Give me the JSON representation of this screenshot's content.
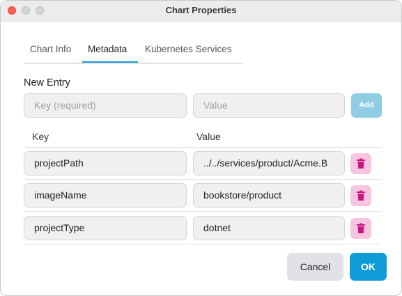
{
  "window": {
    "title": "Chart Properties"
  },
  "tabs": [
    {
      "label": "Chart Info"
    },
    {
      "label": "Metadata"
    },
    {
      "label": "Kubernetes Services"
    }
  ],
  "active_tab": "Metadata",
  "new_entry": {
    "heading": "New Entry",
    "key_placeholder": "Key (required)",
    "value_placeholder": "Value",
    "add_label": "Add"
  },
  "table": {
    "headers": {
      "key": "Key",
      "value": "Value"
    },
    "rows": [
      {
        "key": "projectPath",
        "value": "../../services/product/Acme.B"
      },
      {
        "key": "imageName",
        "value": "bookstore/product"
      },
      {
        "key": "projectType",
        "value": "dotnet"
      }
    ]
  },
  "footer": {
    "cancel_label": "Cancel",
    "ok_label": "OK"
  },
  "colors": {
    "accent": "#0f9bd7",
    "add_disabled": "#8fcde5",
    "delete_bg": "#f6c6e1",
    "delete_icon": "#c8177f"
  },
  "icons": [
    "close-icon",
    "minimize-icon",
    "zoom-icon",
    "trash-icon"
  ]
}
